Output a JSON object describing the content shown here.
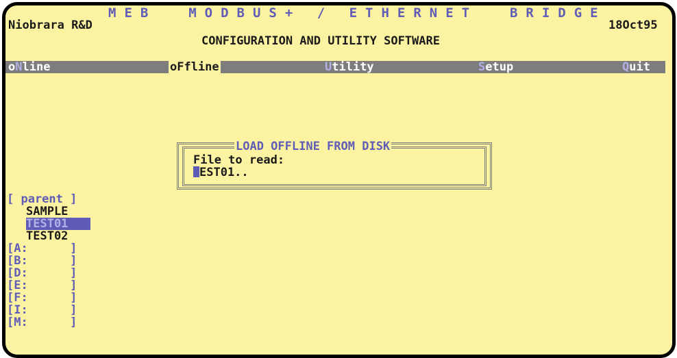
{
  "header": {
    "title": "MEB  MODBUS+ / ETHERNET  BRIDGE",
    "company": "Niobrara R&D",
    "date": "18Oct95",
    "subtitle": "CONFIGURATION AND UTILITY SOFTWARE"
  },
  "menu": {
    "online": {
      "hot": "o",
      "rest_hot": "N",
      "rest": "line"
    },
    "offline": {
      "label": "oFfline"
    },
    "utility": {
      "hot": "U",
      "rest": "tility"
    },
    "setup": {
      "hot": "S",
      "rest": "etup"
    },
    "quit": {
      "hot": "Q",
      "rest": "uit"
    }
  },
  "dialog": {
    "title": "LOAD OFFLINE FROM DISK",
    "prompt": "File to read:",
    "value_rest": "EST01.."
  },
  "file_list": {
    "parent": "[ parent ]",
    "files": [
      "SAMPLE",
      "TEST01",
      "TEST02"
    ],
    "selected": "TEST01",
    "drives": [
      "[A:      ]",
      "[B:      ]",
      "[D:      ]",
      "[E:      ]",
      "[F:      ]",
      "[I:      ]",
      "[M:      ]"
    ]
  },
  "colors": {
    "background": "#fcf3a2",
    "accent": "#5e5cb7",
    "menubar": "#7d7d7d"
  }
}
